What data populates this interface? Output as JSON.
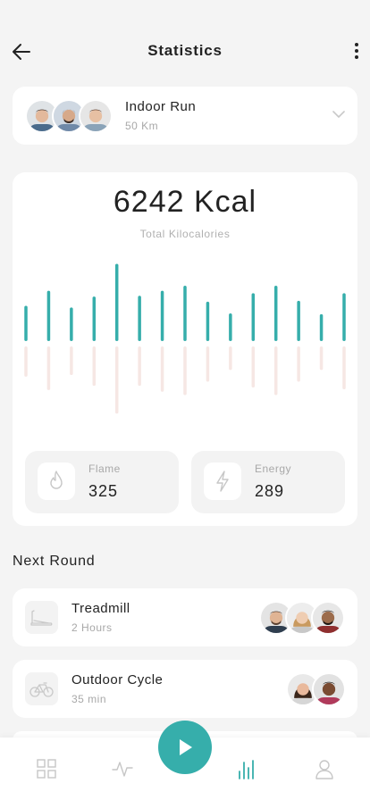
{
  "header": {
    "title": "Statistics"
  },
  "activity": {
    "name": "Indoor Run",
    "distance": "50 Km"
  },
  "stats": {
    "total": "6242 Kcal",
    "total_label": "Total Kilocalories",
    "metrics": [
      {
        "label": "Flame",
        "value": "325",
        "icon": "flame-icon"
      },
      {
        "label": "Energy",
        "value": "289",
        "icon": "lightning-icon"
      }
    ]
  },
  "chart_data": {
    "type": "bar",
    "series": [
      {
        "values": [
          42,
          60,
          40,
          53,
          92,
          54,
          60,
          66,
          47,
          33,
          57,
          66,
          48,
          32,
          57
        ],
        "color": "#36aeab"
      },
      {
        "values": [
          36,
          52,
          34,
          47,
          80,
          47,
          54,
          58,
          42,
          28,
          49,
          58,
          42,
          28,
          51
        ],
        "color": "#f6e7e4"
      }
    ]
  },
  "next_round": {
    "title": "Next Round",
    "items": [
      {
        "name": "Treadmill",
        "duration": "2 Hours",
        "icon": "treadmill-icon"
      },
      {
        "name": "Outdoor Cycle",
        "duration": "35 min",
        "icon": "bicycle-icon"
      }
    ]
  },
  "nav": {
    "items": [
      "grid-icon",
      "activity-icon",
      "play-icon",
      "stats-icon",
      "profile-icon"
    ],
    "active": "stats-icon"
  },
  "colors": {
    "accent": "#36aeab",
    "accent_muted": "#f6e7e4",
    "background": "#f4f4f4"
  }
}
